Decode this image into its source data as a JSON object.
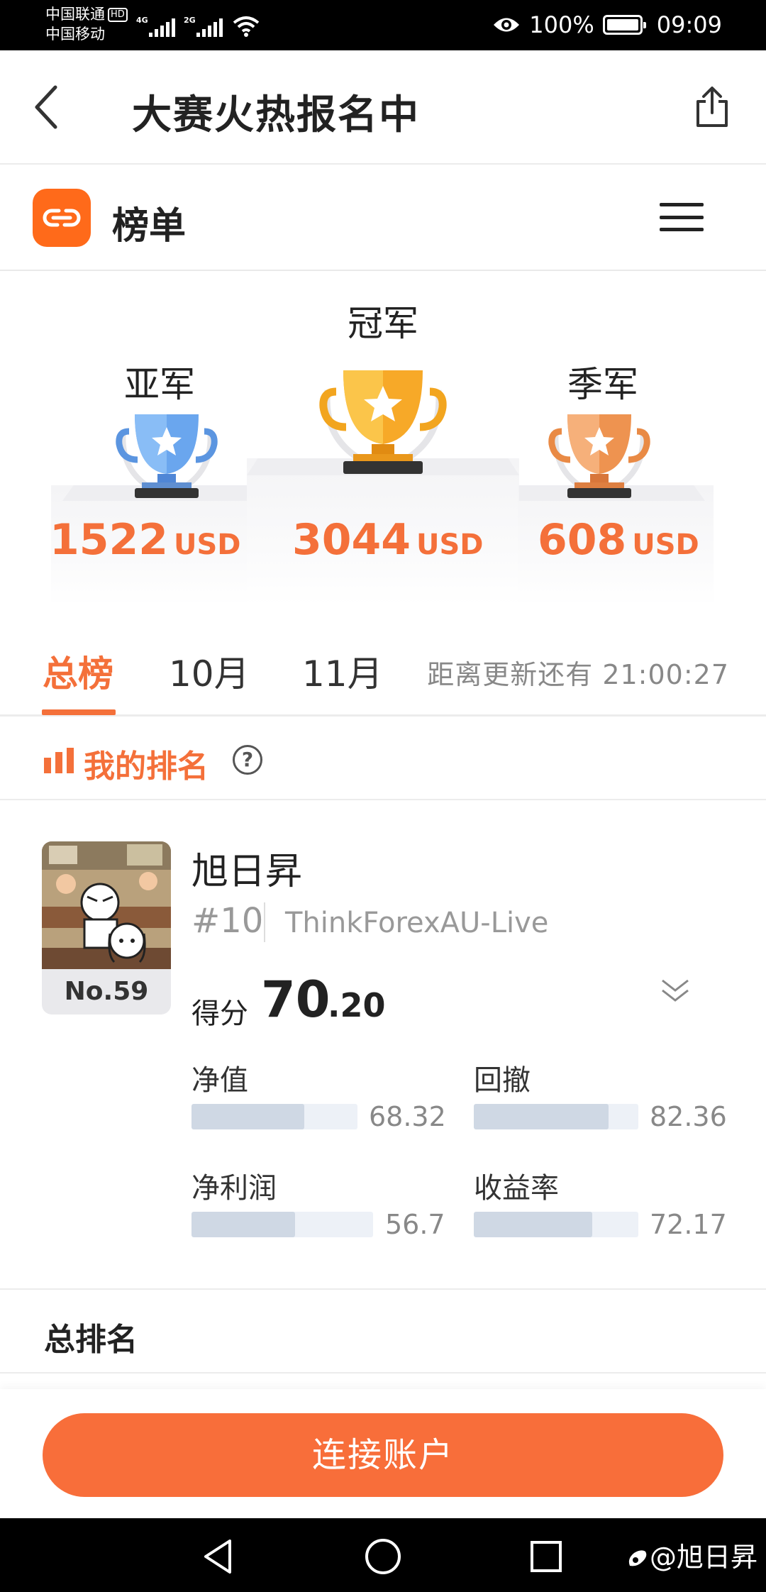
{
  "status_bar": {
    "carrier1": "中国联通",
    "carrier1_badge": "HD",
    "carrier2": "中国移动",
    "signal1_label": "4G",
    "signal2_label": "2G",
    "battery": "100%",
    "time": "09:09"
  },
  "header": {
    "title": "大赛火热报名中"
  },
  "section": {
    "title": "榜单"
  },
  "podium": {
    "second": {
      "label": "亚军",
      "amount": "1522",
      "unit": "USD"
    },
    "first": {
      "label": "冠军",
      "amount": "3044",
      "unit": "USD"
    },
    "third": {
      "label": "季军",
      "amount": "608",
      "unit": "USD"
    }
  },
  "tabs": {
    "items": [
      "总榜",
      "10月",
      "11月"
    ],
    "active": 0,
    "countdown": "距离更新还有 21:00:27"
  },
  "my_ranking": {
    "title": "我的排名",
    "help_icon": "?",
    "avatar_no": "No.59",
    "user_name": "旭日昇",
    "rank": "#10",
    "broker": "ThinkForexAU-Live",
    "score_label": "得分",
    "score_int": "70",
    "score_dec": ".20",
    "metrics": [
      {
        "label": "净值",
        "value": "68.32",
        "fill": 0.68
      },
      {
        "label": "回撤",
        "value": "82.36",
        "fill": 0.82
      },
      {
        "label": "净利润",
        "value": "56.7",
        "fill": 0.57
      },
      {
        "label": "收益率",
        "value": "72.17",
        "fill": 0.72
      }
    ]
  },
  "total_ranking": {
    "title": "总排名"
  },
  "actions": {
    "connect": "连接账户"
  },
  "watermark": "@旭日昇",
  "colors": {
    "accent": "#f4703a",
    "button": "#f86e3a",
    "logo": "#ff6a1a",
    "bar_fill": "#cfd8e4",
    "bar_track": "#edf1f7"
  }
}
